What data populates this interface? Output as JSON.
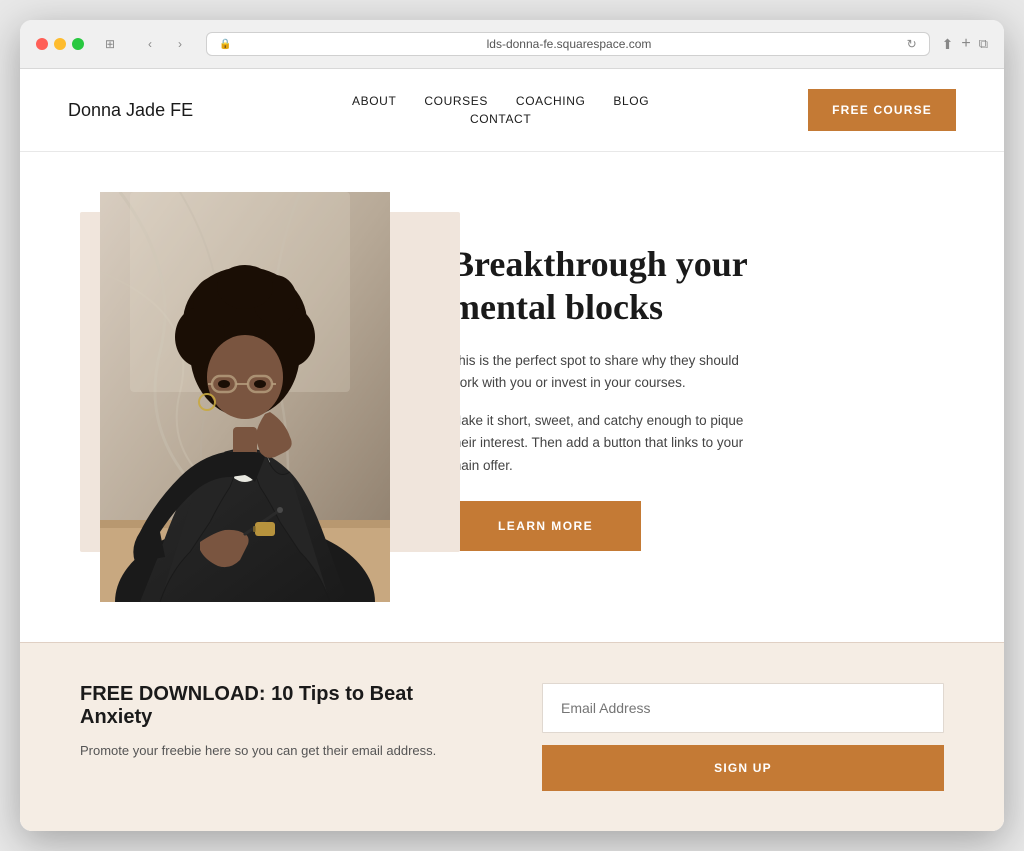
{
  "browser": {
    "url": "lds-donna-fe.squarespace.com",
    "refresh_icon": "↻"
  },
  "header": {
    "logo": "Donna Jade FE",
    "nav": {
      "about": "ABOUT",
      "courses": "COURSES",
      "coaching": "COACHING",
      "blog": "BLOG",
      "contact": "CONTACT"
    },
    "cta_label": "FREE COURSE"
  },
  "hero": {
    "title": "Breakthrough your mental blocks",
    "desc1": "This is the perfect spot to share why they should work with you or invest in your courses.",
    "desc2": "Make it short, sweet, and catchy enough to pique their interest. Then add a button that links to your main offer.",
    "learn_more": "LEARN MORE"
  },
  "signup": {
    "title": "FREE DOWNLOAD: 10 Tips to Beat Anxiety",
    "desc": "Promote your freebie here so you can get their email address.",
    "email_placeholder": "Email Address",
    "button_label": "SIGN UP"
  },
  "colors": {
    "accent": "#c47a35",
    "bg_light": "#f5ede4",
    "hero_bg": "#f0e5dc"
  }
}
